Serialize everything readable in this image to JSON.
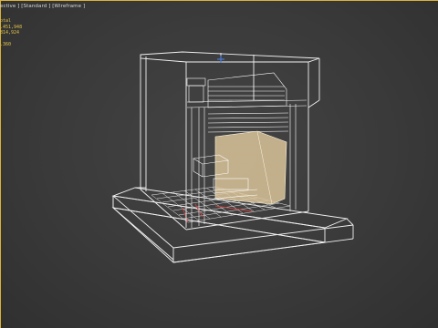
{
  "viewport": {
    "label": "ective ] [Standard ] [Wireframe ]",
    "stats": [
      {
        "id": "total",
        "text": "otal"
      },
      {
        "id": "polys",
        "text": ".451,948"
      },
      {
        "id": "verts",
        "text": "814,924"
      },
      {
        "id": "fps",
        "text": ".360"
      }
    ]
  },
  "colors": {
    "background": "#3b3b3b",
    "frame_highlight": "#d9b23a",
    "stats_text": "#e1c04a",
    "wireframe": "#f2f2f2",
    "mattress_fill": "#d9c39a",
    "accent_red": "#d04040",
    "gizmo_blue": "#4a7bd8"
  },
  "scene": {
    "object": "wireframe-cabinet-room-model",
    "view_mode": "Wireframe"
  }
}
